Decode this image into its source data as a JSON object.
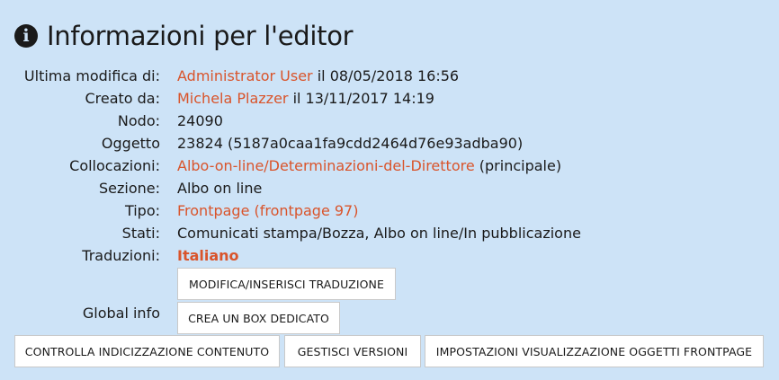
{
  "header": {
    "title": "Informazioni per l'editor",
    "icon": "info-circle-icon"
  },
  "fields": {
    "last_modified": {
      "label": "Ultima modifica di:",
      "user": "Administrator User",
      "suffix": " il 08/05/2018 16:56"
    },
    "created": {
      "label": "Creato da:",
      "user": "Michela Plazzer",
      "suffix": " il 13/11/2017 14:19"
    },
    "node": {
      "label": "Nodo:",
      "value": "24090"
    },
    "object": {
      "label": "Oggetto",
      "value": "23824 (5187a0caa1fa9cdd2464d76e93adba90)"
    },
    "locations": {
      "label": "Collocazioni:",
      "link": "Albo-on-line/Determinazioni-del-Direttore",
      "suffix": " (principale)"
    },
    "section": {
      "label": "Sezione:",
      "value": "Albo on line"
    },
    "type": {
      "label": "Tipo:",
      "link": "Frontpage (frontpage 97)"
    },
    "states": {
      "label": "Stati:",
      "value": "Comunicati stampa/Bozza, Albo on line/In pubblicazione"
    },
    "translations": {
      "label": "Traduzioni:",
      "link": "Italiano"
    }
  },
  "buttons": {
    "edit_translation": "MODIFICA/INSERISCI TRADUZIONE",
    "create_box": "CREA UN BOX DEDICATO",
    "check_indexing": "CONTROLLA INDICIZZAZIONE CONTENUTO",
    "manage_versions": "GESTISCI VERSIONI",
    "frontpage_settings": "IMPOSTAZIONI VISUALIZZAZIONE OGGETTI FRONTPAGE"
  },
  "global_info": {
    "label": "Global info"
  },
  "colors": {
    "background": "#cde3f7",
    "link": "#d9542b",
    "text": "#1a1a1a",
    "button_bg": "#ffffff"
  }
}
